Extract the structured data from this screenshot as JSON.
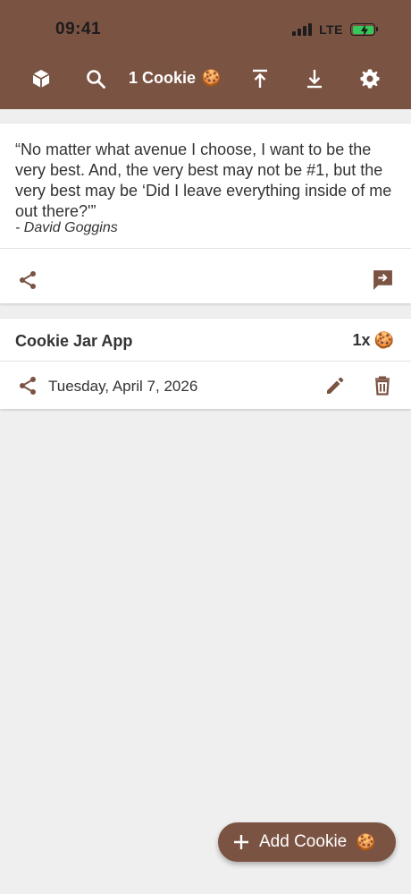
{
  "status_bar": {
    "time": "09:41",
    "network": "LTE"
  },
  "toolbar": {
    "title": "1 Cookie",
    "title_emoji": "🍪",
    "icons": [
      "cube-icon",
      "search-icon",
      "upload-icon",
      "download-icon",
      "gear-icon"
    ]
  },
  "quote": {
    "text": "“No matter what avenue I choose, I want to be the very best. And, the very best may not be #1, but the very best may be ‘Did I leave everything inside of me out there?'”",
    "author": "- David Goggins"
  },
  "jar": {
    "title": "Cookie Jar App",
    "count": "1x",
    "count_emoji": "🍪",
    "date": "Tuesday, April 7, 2026"
  },
  "fab": {
    "label": "Add Cookie",
    "emoji": "🍪"
  },
  "colors": {
    "primary": "#7b5343",
    "background": "#efefef",
    "card": "#ffffff",
    "battery": "#34c759"
  }
}
